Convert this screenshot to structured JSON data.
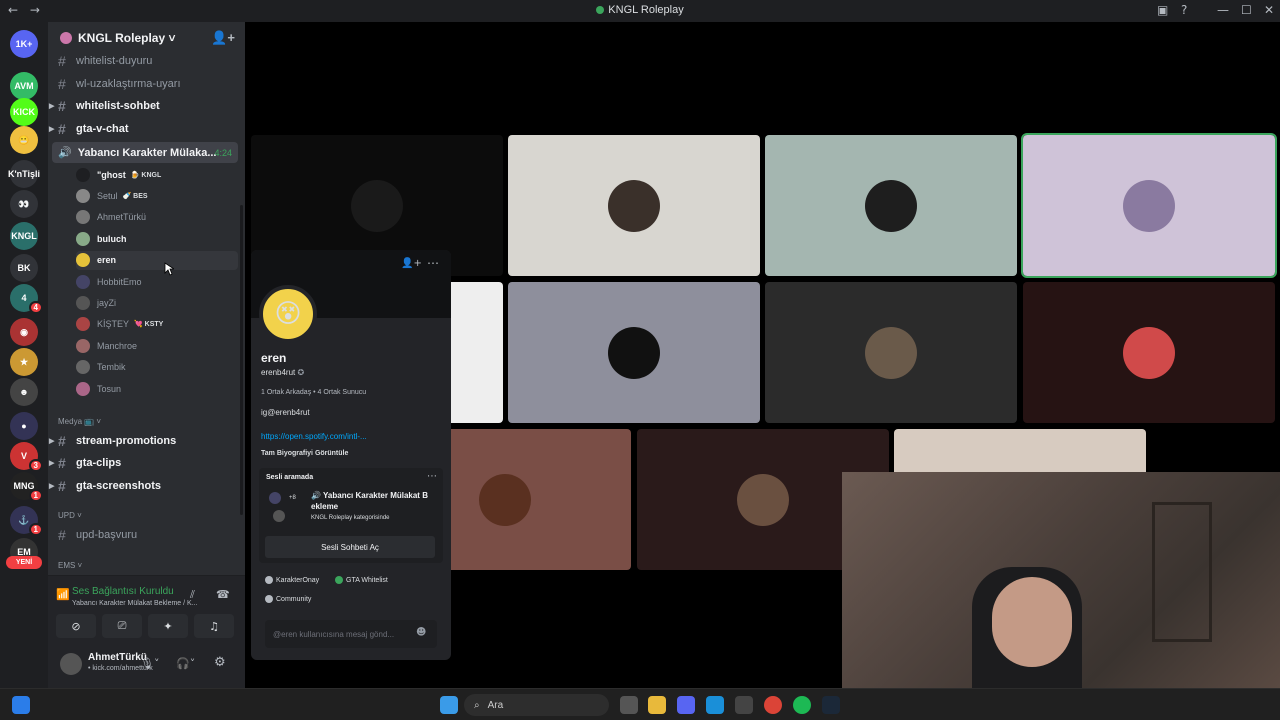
{
  "window": {
    "title": "KNGL Roleplay",
    "nav": "← →"
  },
  "servers": [
    {
      "label": "1K+",
      "color": "#5865f2",
      "badge": ""
    },
    {
      "label": "AVM",
      "color": "#3b6",
      "badge": ""
    },
    {
      "label": "KICK",
      "color": "#53fc18",
      "badge": ""
    },
    {
      "label": "😬",
      "color": "#f0c040",
      "badge": ""
    },
    {
      "label": "K'nTişli",
      "color": "#313338",
      "badge": ""
    },
    {
      "label": "👀",
      "color": "#313338",
      "badge": ""
    },
    {
      "label": "KNGL",
      "color": "#2a6f6a",
      "badge": ""
    },
    {
      "label": "BK",
      "color": "#313338",
      "badge": ""
    },
    {
      "label": "4",
      "color": "#2a6f6a",
      "badge": "4"
    },
    {
      "label": "◉",
      "color": "#a33",
      "badge": ""
    },
    {
      "label": "★",
      "color": "#c93",
      "badge": ""
    },
    {
      "label": "☻",
      "color": "#444",
      "badge": ""
    },
    {
      "label": "●",
      "color": "#335",
      "badge": ""
    },
    {
      "label": "V",
      "color": "#c33",
      "badge": "3"
    },
    {
      "label": "MNG",
      "color": "#222",
      "badge": "1"
    },
    {
      "label": "⚓",
      "color": "#335",
      "badge": "1"
    },
    {
      "label": "EM",
      "color": "#333",
      "badge": ""
    }
  ],
  "new_label": "YENİ",
  "guild": {
    "name": "KNGL Roleplay ˅"
  },
  "channels_top": [
    {
      "name": "whitelist-duyuru",
      "bold": false
    },
    {
      "name": "wl-uzaklaştırma-uyarı",
      "bold": false
    },
    {
      "name": "whitelist-sohbet",
      "bold": true
    },
    {
      "name": "gta-v-chat",
      "bold": true
    }
  ],
  "voice_channel": {
    "name": "Yabancı Karakter Mülaka...",
    "time": "4:24"
  },
  "members": [
    {
      "name": "\"ghost",
      "tag": "🍺 KNGL",
      "color": "#1e1f22",
      "bold": true
    },
    {
      "name": "Setul",
      "tag": "🍼 BES",
      "color": "#888",
      "bold": false
    },
    {
      "name": "AhmetTürkü",
      "tag": "",
      "color": "#777",
      "bold": false
    },
    {
      "name": "buluch",
      "tag": "",
      "color": "#8a8",
      "bold": true
    },
    {
      "name": "eren",
      "tag": "",
      "color": "#e5c23a",
      "bold": true
    },
    {
      "name": "HobbitEmo",
      "tag": "",
      "color": "#446",
      "bold": false
    },
    {
      "name": "jayZi",
      "tag": "",
      "color": "#555",
      "bold": false
    },
    {
      "name": "KİŞTEY",
      "tag": "💘 KSTY",
      "color": "#a44",
      "bold": false
    },
    {
      "name": "Manchroe",
      "tag": "",
      "color": "#966",
      "bold": false
    },
    {
      "name": "Tembik",
      "tag": "",
      "color": "#666",
      "bold": false
    },
    {
      "name": "Tosun",
      "tag": "",
      "color": "#a68",
      "bold": false
    }
  ],
  "category_media": "Medya 📺 ˅",
  "channels_media": [
    "stream-promotions",
    "gta-clips",
    "gta-screenshots"
  ],
  "category_upd": "UPD ˅",
  "channels_upd": [
    "upd-başvuru"
  ],
  "category_ems": "EMS ˅",
  "voicebar": {
    "status": "Ses Bağlantısı Kuruldu",
    "sub": "Yabancı Karakter Mülakat Bekleme / K..."
  },
  "user": {
    "name": "AhmetTürkü",
    "status": "• kick.com/ahmetturk"
  },
  "profile": {
    "name": "eren",
    "username": "erenb4rut",
    "mutual": "1 Ortak Arkadaş • 4 Ortak Sunucu",
    "bio": "ig@erenb4rut",
    "link": "https://open.spotify.com/intl-...",
    "full_bio": "Tam Biyografiyi Görüntüle",
    "voice_heading": "Sesli aramada",
    "voice_more": "+8",
    "voice_channel": "🔊 Yabancı Karakter Mülakat B ekleme",
    "voice_category": "KNGL Roleplay kategorisinde",
    "voice_button": "Sesli Sohbeti Aç",
    "roles": [
      {
        "name": "KarakterOnay",
        "color": "#b5bac1"
      },
      {
        "name": "GTA Whitelist",
        "color": "#3ba55c"
      },
      {
        "name": "Community",
        "color": "#b5bac1"
      }
    ],
    "message_placeholder": "@eren kullanıcısına mesaj gönd..."
  },
  "tiles": [
    {
      "bg": "#0c0c0c",
      "av": "#1a1a1a"
    },
    {
      "bg": "#d8d6d0",
      "av": "#3a302a"
    },
    {
      "bg": "#a4b6b0",
      "av": "#1e1e1e"
    },
    {
      "bg": "#cfc3d8",
      "av": "#8a7aa0"
    },
    {
      "bg": "#eeeeee",
      "av": "#eeeeee"
    },
    {
      "bg": "#8e8f9c",
      "av": "#111"
    },
    {
      "bg": "#2b2b2b",
      "av": "#6a5a4a"
    },
    {
      "bg": "#261313",
      "av": "#d04a4a"
    },
    {
      "bg": "#7a4e46",
      "av": "#5a3020"
    },
    {
      "bg": "#2a1a1a",
      "av": "#6a5040"
    },
    {
      "bg": "#d7cbc0",
      "av": "#d7cbc0"
    }
  ],
  "taskbar": {
    "search": "Ara"
  }
}
